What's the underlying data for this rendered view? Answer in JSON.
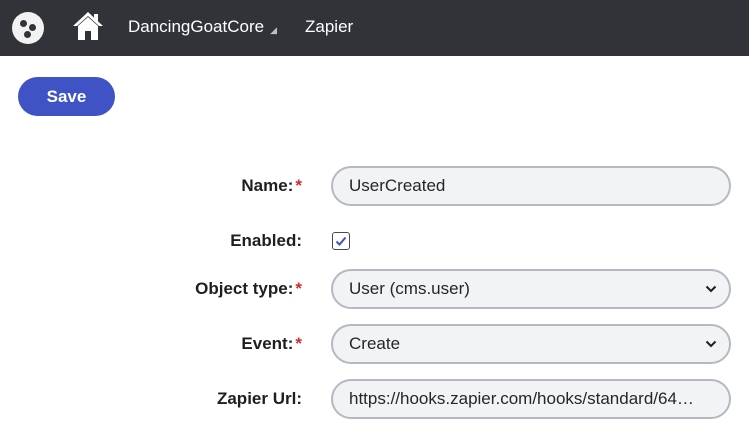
{
  "header": {
    "site_name": "DancingGoatCore",
    "current_page": "Zapier"
  },
  "toolbar": {
    "save_label": "Save"
  },
  "form": {
    "name": {
      "label": "Name:",
      "required_mark": "*",
      "value": "UserCreated"
    },
    "enabled": {
      "label": "Enabled:",
      "checked": true
    },
    "object_type": {
      "label": "Object type:",
      "required_mark": "*",
      "value": "User (cms.user)"
    },
    "event": {
      "label": "Event:",
      "required_mark": "*",
      "value": "Create"
    },
    "zapier_url": {
      "label": "Zapier Url:",
      "value": "https://hooks.zapier.com/hooks/standard/64…"
    }
  },
  "colors": {
    "topbar": "#323338",
    "accent": "#3f53c4",
    "required": "#d12b2b",
    "field_border": "#b6b8c2",
    "field_bg": "#f2f3f5"
  },
  "icons": {
    "app": "app-menu-icon",
    "home": "home-icon",
    "site_caret": "caret-down-icon",
    "select": "chevron-down-icon",
    "check": "checkmark-icon"
  }
}
